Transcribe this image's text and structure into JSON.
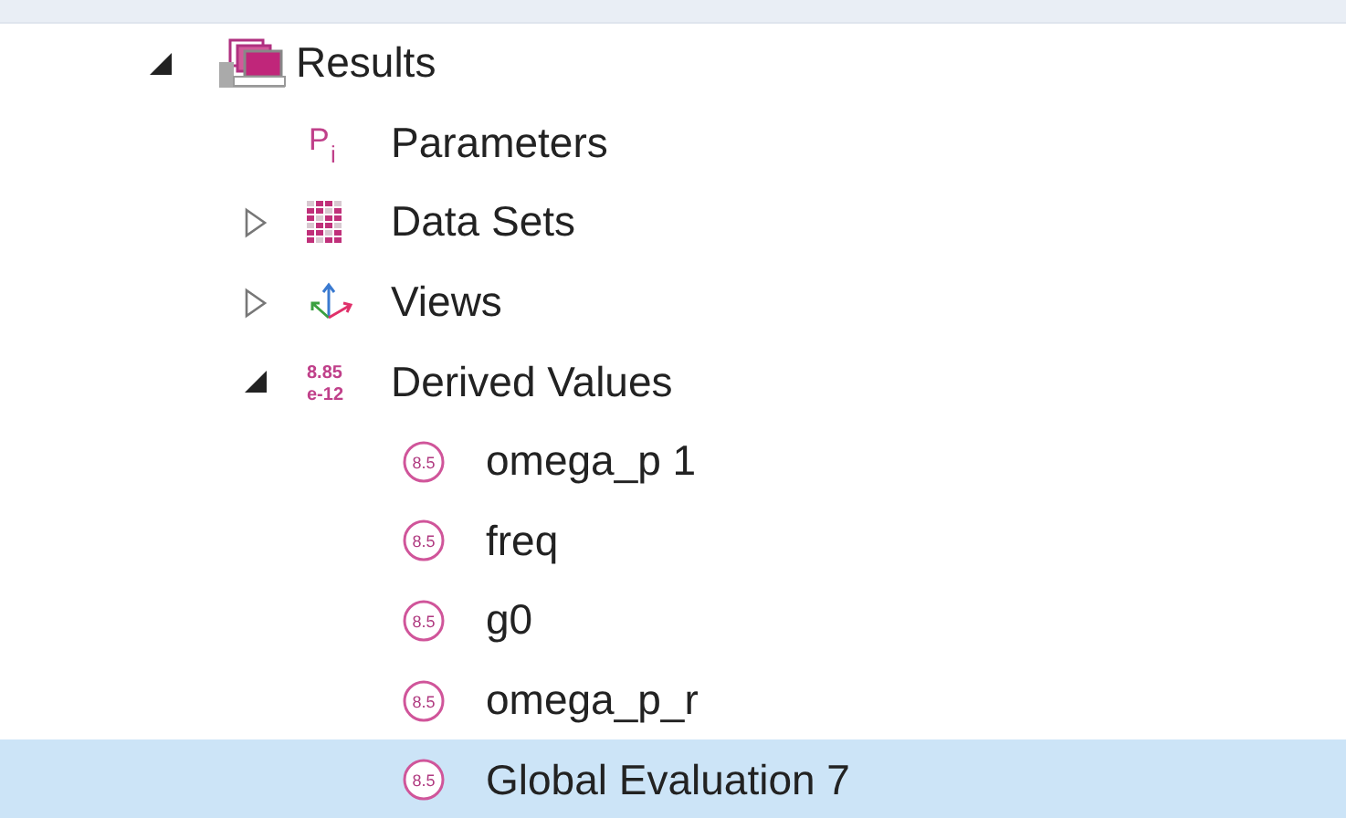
{
  "tree": [
    {
      "label": "Results",
      "kind": "results",
      "expanded": true,
      "selected": false,
      "children": [
        {
          "label": "Parameters",
          "kind": "parameters",
          "icon_text": "P",
          "icon_sub": "i",
          "selected": false
        },
        {
          "label": "Data Sets",
          "kind": "datasets",
          "expanded": false,
          "selected": false
        },
        {
          "label": "Views",
          "kind": "views",
          "expanded": false,
          "selected": false
        },
        {
          "label": "Derived Values",
          "kind": "derived",
          "icon_text": "8.85",
          "icon_sub": "e-12",
          "expanded": true,
          "selected": false,
          "children": [
            {
              "label": "omega_p 1",
              "kind": "value",
              "icon_text": "8.5",
              "selected": false
            },
            {
              "label": "freq",
              "kind": "value",
              "icon_text": "8.5",
              "selected": false
            },
            {
              "label": "g0",
              "kind": "value",
              "icon_text": "8.5",
              "selected": false
            },
            {
              "label": "omega_p_r",
              "kind": "value",
              "icon_text": "8.5",
              "selected": false
            },
            {
              "label": "Global Evaluation 7",
              "kind": "value",
              "icon_text": "8.5",
              "selected": true
            }
          ]
        }
      ]
    }
  ]
}
